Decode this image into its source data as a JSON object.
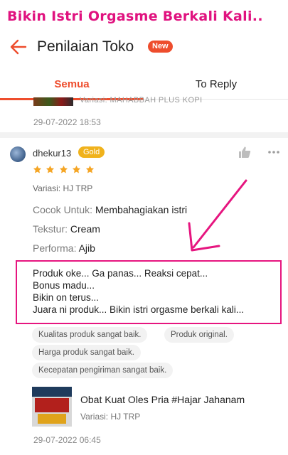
{
  "caption": "Bikin Istri Orgasme Berkali Kali..",
  "header": {
    "title": "Penilaian Toko",
    "badge": "New"
  },
  "tabs": [
    {
      "label": "Semua",
      "active": true
    },
    {
      "label": "To Reply",
      "active": false
    }
  ],
  "previous_review": {
    "variation": "Variasi: MAHABBAH PLUS KOPI",
    "date": "29-07-2022 18:53"
  },
  "review": {
    "username": "dhekur13",
    "badge": "Gold",
    "rating": 5,
    "variation": "Variasi: HJ TRP",
    "attributes": [
      {
        "key": "Cocok Untuk:",
        "value": "Membahagiakan istri"
      },
      {
        "key": "Tekstur:",
        "value": "Cream"
      },
      {
        "key": "Performa:",
        "value": "Ajib"
      }
    ],
    "comment": "Produk oke... Ga panas... Reaksi cepat...\nBonus madu...\nBikin on terus...\nJuara ni produk... Bikin istri orgasme berkali kali...",
    "tags": [
      "Kualitas produk sangat baik.",
      "Produk original.",
      "Harga produk sangat baik.",
      "Kecepatan pengiriman sangat baik."
    ],
    "product": {
      "name": "Obat Kuat Oles Pria #Hajar Jahanam",
      "variation": "Variasi: HJ TRP"
    },
    "date": "29-07-2022 06:45"
  },
  "colors": {
    "accent": "#ee4d2d",
    "gold": "#f0b21c",
    "annotation": "#e6157f"
  },
  "icons": [
    "back-arrow-icon",
    "thumbs-up-icon",
    "more-dots-icon",
    "star-icon"
  ]
}
